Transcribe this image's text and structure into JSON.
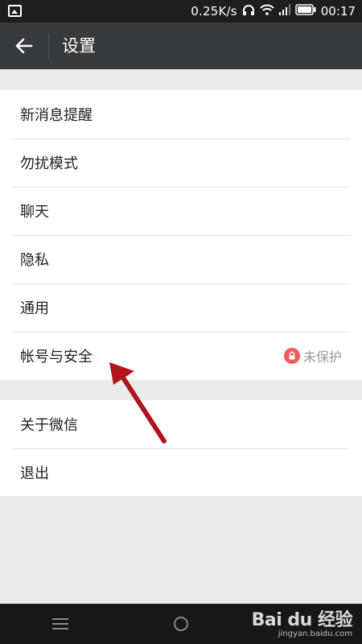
{
  "status_bar": {
    "net_speed": "0.25K/s",
    "time": "00:17"
  },
  "header": {
    "title": "设置",
    "back_icon": "arrow-left-icon"
  },
  "settings_groups": [
    {
      "items": [
        {
          "label": "新消息提醒"
        },
        {
          "label": "勿扰模式"
        },
        {
          "label": "聊天"
        },
        {
          "label": "隐私"
        },
        {
          "label": "通用"
        },
        {
          "label": "帐号与安全",
          "value": "未保护",
          "value_icon": "lock-icon"
        }
      ]
    },
    {
      "items": [
        {
          "label": "关于微信"
        },
        {
          "label": "退出"
        }
      ]
    }
  ],
  "watermark": {
    "brand": "Bai du 经验",
    "url": "jingyan.baidu.com"
  },
  "colors": {
    "action_bar": "#383b3d",
    "status_bar": "#1e1e1e",
    "lock_badge": "#ef5a5a",
    "annotation_arrow": "#b0141c",
    "background": "#ebebeb"
  }
}
